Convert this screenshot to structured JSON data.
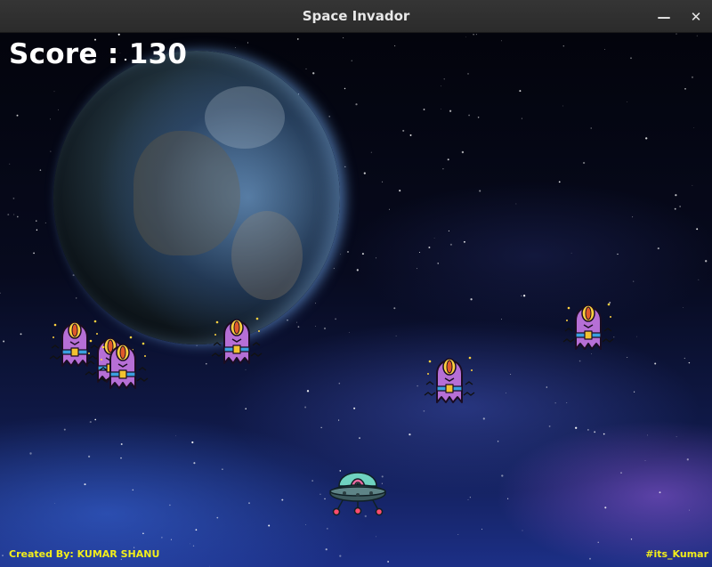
{
  "window": {
    "title": "Space Invador",
    "minimize_icon": "minimize-icon",
    "close_icon": "close-icon"
  },
  "hud": {
    "score_text": "Score : 130"
  },
  "footer": {
    "credit_left": "Created By: KUMAR SHANU",
    "credit_right": "#its_Kumar"
  },
  "sprites": {
    "enemy": {
      "count": 6,
      "body_color": "#b66fd6",
      "eye_color": "#e05a2a",
      "belt_color": "#3aa0e0"
    },
    "player": {
      "dome_color": "#6fd3c0",
      "alien_color": "#e86aa0",
      "saucer_color": "#3d5a5e",
      "light_color": "#ff4d6d"
    }
  },
  "colors": {
    "score_text": "#ffffff",
    "credit_text": "#f3ef1a",
    "titlebar": "#2f2f2f"
  }
}
